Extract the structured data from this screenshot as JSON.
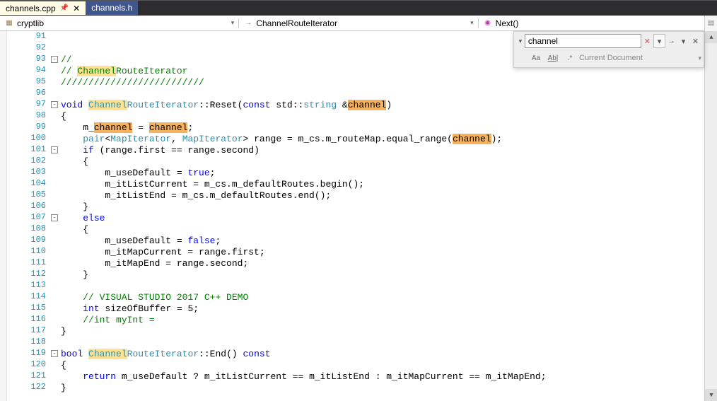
{
  "tabs": [
    {
      "label": "channels.cpp",
      "active": true,
      "pinned": true
    },
    {
      "label": "channels.h",
      "active": false,
      "pinned": false
    }
  ],
  "nav": {
    "scope": "cryptlib",
    "class": "ChannelRouteIterator",
    "member": "Next()"
  },
  "find": {
    "value": "channel",
    "scope": "Current Document",
    "match_case_label": "Aa",
    "whole_word_label": "Ab|",
    "regex_label": ".*"
  },
  "line_start": 91,
  "code_lines": [
    {
      "n": 91,
      "seg": [
        {
          "t": ""
        }
      ]
    },
    {
      "n": 92,
      "seg": [
        {
          "t": ""
        }
      ]
    },
    {
      "n": 93,
      "fold": true,
      "open": true,
      "seg": [
        {
          "t": "//",
          "c": "cm"
        }
      ]
    },
    {
      "n": 94,
      "seg": [
        {
          "t": "// ",
          "c": "cm"
        },
        {
          "t": "Channel",
          "c": "cm hl-y"
        },
        {
          "t": "RouteIterator",
          "c": "cm"
        }
      ]
    },
    {
      "n": 95,
      "seg": [
        {
          "t": "//////////////////////////",
          "c": "cm"
        }
      ]
    },
    {
      "n": 96,
      "seg": [
        {
          "t": ""
        }
      ]
    },
    {
      "n": 97,
      "fold": true,
      "open": true,
      "seg": [
        {
          "t": "void",
          "c": "kw"
        },
        {
          "t": " "
        },
        {
          "t": "Channel",
          "c": "type hl-y"
        },
        {
          "t": "RouteIterator",
          "c": "type"
        },
        {
          "t": "::Reset("
        },
        {
          "t": "const",
          "c": "kw"
        },
        {
          "t": " std::"
        },
        {
          "t": "string",
          "c": "type"
        },
        {
          "t": " &"
        },
        {
          "t": "channel",
          "c": "hl-o"
        },
        {
          "t": ")"
        }
      ]
    },
    {
      "n": 98,
      "seg": [
        {
          "t": "{"
        }
      ]
    },
    {
      "n": 99,
      "seg": [
        {
          "t": "    m_"
        },
        {
          "t": "channel",
          "c": "hl-o"
        },
        {
          "t": " = "
        },
        {
          "t": "channel",
          "c": "hl-o"
        },
        {
          "t": ";"
        }
      ]
    },
    {
      "n": 100,
      "seg": [
        {
          "t": "    "
        },
        {
          "t": "pair",
          "c": "type"
        },
        {
          "t": "<"
        },
        {
          "t": "MapIterator",
          "c": "type"
        },
        {
          "t": ", "
        },
        {
          "t": "MapIterator",
          "c": "type"
        },
        {
          "t": "> range = m_cs.m_routeMap.equal_range("
        },
        {
          "t": "channel",
          "c": "hl-o"
        },
        {
          "t": ");"
        }
      ]
    },
    {
      "n": 101,
      "fold": true,
      "open": true,
      "seg": [
        {
          "t": "    "
        },
        {
          "t": "if",
          "c": "kw"
        },
        {
          "t": " (range.first == range.second)"
        }
      ]
    },
    {
      "n": 102,
      "seg": [
        {
          "t": "    {"
        }
      ]
    },
    {
      "n": 103,
      "seg": [
        {
          "t": "        m_useDefault = "
        },
        {
          "t": "true",
          "c": "kw"
        },
        {
          "t": ";"
        }
      ]
    },
    {
      "n": 104,
      "seg": [
        {
          "t": "        m_itListCurrent = m_cs.m_defaultRoutes.begin();"
        }
      ]
    },
    {
      "n": 105,
      "seg": [
        {
          "t": "        m_itListEnd = m_cs.m_defaultRoutes.end();"
        }
      ]
    },
    {
      "n": 106,
      "seg": [
        {
          "t": "    }"
        }
      ]
    },
    {
      "n": 107,
      "fold": true,
      "open": true,
      "seg": [
        {
          "t": "    "
        },
        {
          "t": "else",
          "c": "kw"
        }
      ]
    },
    {
      "n": 108,
      "seg": [
        {
          "t": "    {"
        }
      ]
    },
    {
      "n": 109,
      "seg": [
        {
          "t": "        m_useDefault = "
        },
        {
          "t": "false",
          "c": "kw"
        },
        {
          "t": ";"
        }
      ]
    },
    {
      "n": 110,
      "seg": [
        {
          "t": "        m_itMapCurrent = range.first;"
        }
      ]
    },
    {
      "n": 111,
      "seg": [
        {
          "t": "        m_itMapEnd = range.second;"
        }
      ]
    },
    {
      "n": 112,
      "seg": [
        {
          "t": "    }"
        }
      ]
    },
    {
      "n": 113,
      "seg": [
        {
          "t": ""
        }
      ]
    },
    {
      "n": 114,
      "seg": [
        {
          "t": "    "
        },
        {
          "t": "// VISUAL STUDIO 2017 C++ DEMO",
          "c": "cm"
        }
      ]
    },
    {
      "n": 115,
      "seg": [
        {
          "t": "    "
        },
        {
          "t": "int",
          "c": "kw"
        },
        {
          "t": " sizeOfBuffer = 5;"
        }
      ]
    },
    {
      "n": 116,
      "seg": [
        {
          "t": "    "
        },
        {
          "t": "//int myInt = ",
          "c": "cm"
        }
      ]
    },
    {
      "n": 117,
      "seg": [
        {
          "t": "}"
        }
      ]
    },
    {
      "n": 118,
      "seg": [
        {
          "t": ""
        }
      ]
    },
    {
      "n": 119,
      "fold": true,
      "open": true,
      "seg": [
        {
          "t": "bool",
          "c": "kw"
        },
        {
          "t": " "
        },
        {
          "t": "Channel",
          "c": "type hl-y"
        },
        {
          "t": "RouteIterator",
          "c": "type"
        },
        {
          "t": "::End() "
        },
        {
          "t": "const",
          "c": "kw"
        }
      ]
    },
    {
      "n": 120,
      "seg": [
        {
          "t": "{"
        }
      ]
    },
    {
      "n": 121,
      "seg": [
        {
          "t": "    "
        },
        {
          "t": "return",
          "c": "kw"
        },
        {
          "t": " m_useDefault ? m_itListCurrent == m_itListEnd : m_itMapCurrent == m_itMapEnd;"
        }
      ]
    },
    {
      "n": 122,
      "seg": [
        {
          "t": "}"
        }
      ]
    }
  ]
}
